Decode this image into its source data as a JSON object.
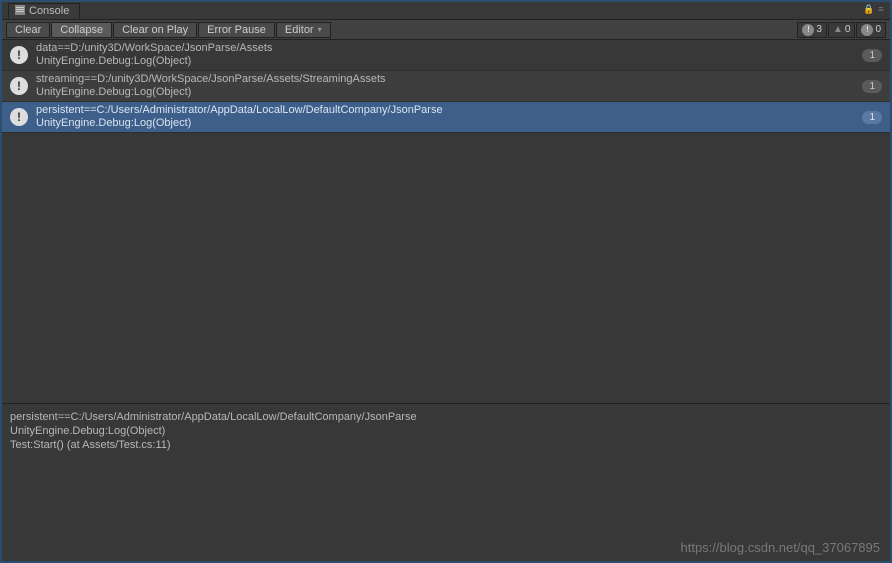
{
  "title": "Console",
  "toolbar": {
    "clear": "Clear",
    "collapse": "Collapse",
    "clearOnPlay": "Clear on Play",
    "errorPause": "Error Pause",
    "editor": "Editor"
  },
  "status": {
    "info_count": "3",
    "warn_count": "0",
    "error_count": "0"
  },
  "logs": [
    {
      "line1": "data==D:/unity3D/WorkSpace/JsonParse/Assets",
      "line2": "UnityEngine.Debug:Log(Object)",
      "count": "1",
      "selected": false,
      "odd": false
    },
    {
      "line1": "streaming==D:/unity3D/WorkSpace/JsonParse/Assets/StreamingAssets",
      "line2": "UnityEngine.Debug:Log(Object)",
      "count": "1",
      "selected": false,
      "odd": true
    },
    {
      "line1": "persistent==C:/Users/Administrator/AppData/LocalLow/DefaultCompany/JsonParse",
      "line2": "UnityEngine.Debug:Log(Object)",
      "count": "1",
      "selected": true,
      "odd": false
    }
  ],
  "detail": {
    "l1": "persistent==C:/Users/Administrator/AppData/LocalLow/DefaultCompany/JsonParse",
    "l2": "UnityEngine.Debug:Log(Object)",
    "l3": "Test:Start() (at Assets/Test.cs:11)"
  },
  "watermark": "https://blog.csdn.net/qq_37067895"
}
